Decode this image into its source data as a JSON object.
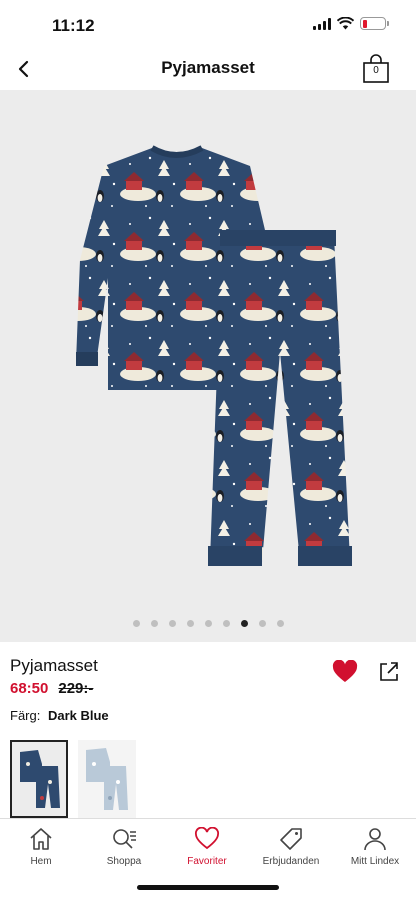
{
  "status": {
    "time": "11:12",
    "battery_level": 0.2
  },
  "nav": {
    "title": "Pyjamasset",
    "bag_count": "0"
  },
  "gallery": {
    "image_count": 9,
    "active_index": 6,
    "fabric_color": "#2e4a6f"
  },
  "product": {
    "name": "Pyjamasset",
    "sale_price": "68:50",
    "original_price": "229:-",
    "color_label": "Färg:",
    "color_value": "Dark Blue",
    "favorited": true
  },
  "swatches": [
    {
      "name": "Dark Blue",
      "color": "#2e4a6f",
      "selected": true
    },
    {
      "name": "Light Blue",
      "color": "#b9c9d8",
      "selected": false
    }
  ],
  "tabs": [
    {
      "label": "Hem",
      "icon": "home-icon"
    },
    {
      "label": "Shoppa",
      "icon": "search-list-icon"
    },
    {
      "label": "Favoriter",
      "icon": "heart-icon",
      "active": true
    },
    {
      "label": "Erbjudanden",
      "icon": "tag-icon"
    },
    {
      "label": "Mitt Lindex",
      "icon": "person-icon"
    }
  ],
  "colors": {
    "accent": "#d1102f",
    "gallery_bg": "#ececec"
  }
}
